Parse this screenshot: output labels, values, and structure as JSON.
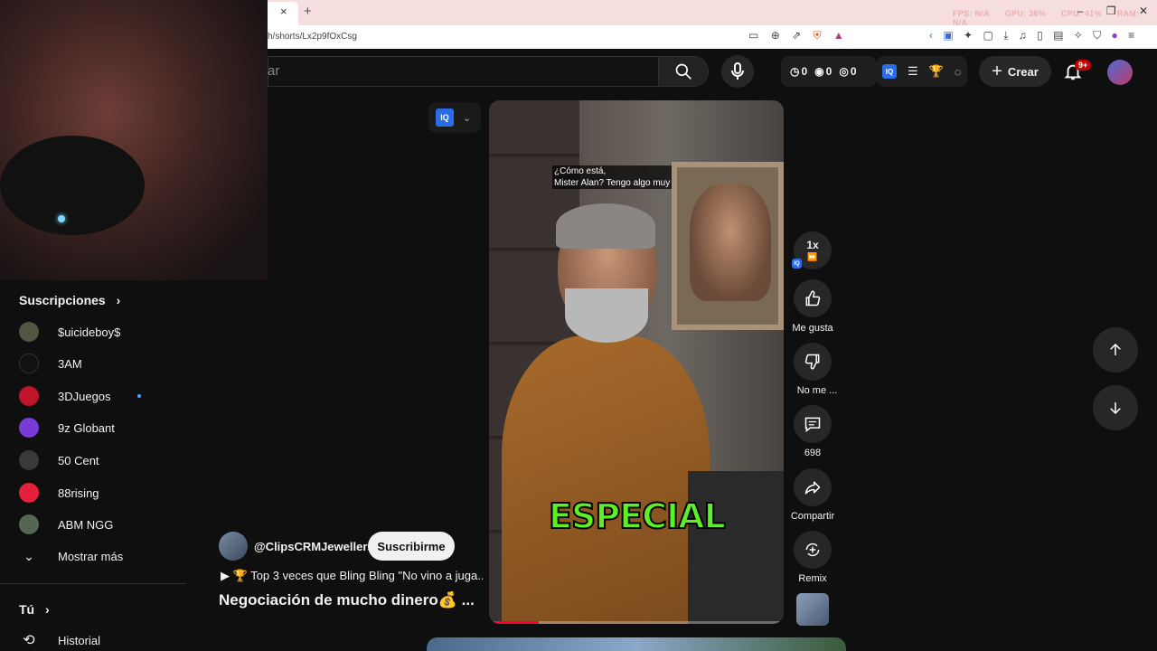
{
  "browser": {
    "tab_close": "×",
    "new_tab": "+",
    "url": "h/shorts/Lx2p9fOxCsg",
    "stats": [
      "FPS: N/A",
      "GPU: 36%",
      "CPU: 41%",
      "RAM: N/A"
    ],
    "window_buttons": [
      "–",
      "❐",
      "✕"
    ]
  },
  "header": {
    "search_placeholder": "ar",
    "counters": [
      "0",
      "0",
      "0"
    ],
    "iq_label": "IQ",
    "create_label": "Crear",
    "notif_badge": "9+"
  },
  "sidebar": {
    "subs_title": "Suscripciones",
    "subs_arrow": "›",
    "subscriptions": [
      {
        "name": "$uicideboy$",
        "color": "#555544"
      },
      {
        "name": "3AM",
        "color": "#111111"
      },
      {
        "name": "3DJuegos",
        "color": "#c0142c"
      },
      {
        "name": "9z Globant",
        "color": "#7a3ad6"
      },
      {
        "name": "50 Cent",
        "color": "#3a3a3a"
      },
      {
        "name": "88rising",
        "color": "#e3213a"
      },
      {
        "name": "ABM NGG",
        "color": "#556655"
      }
    ],
    "show_more": "Mostrar más",
    "you_title": "Tú",
    "you_arrow": "›",
    "history": "Historial"
  },
  "video": {
    "caption_small_1": "¿Cómo está,",
    "caption_small_2": "Mister Alan? Tengo algo muy",
    "caption_big": "ESPECIAL",
    "progress": 0.17
  },
  "channel": {
    "handle": "@ClipsCRMJewellers",
    "subscribe_label": "Suscribirme",
    "playlist_text": "🏆 Top 3 veces que Bling Bling \"No vino a juga...",
    "title": "Negociación de mucho dinero💰 ..."
  },
  "actions": {
    "speed": "1x",
    "like_label": "Me gusta",
    "dislike_label": "No me ...",
    "comments_count": "698",
    "share_label": "Compartir",
    "remix_label": "Remix"
  },
  "colors": {
    "accent_red": "#ff0033",
    "caption_green": "#5cf026",
    "iq_blue": "#2b6de8"
  }
}
